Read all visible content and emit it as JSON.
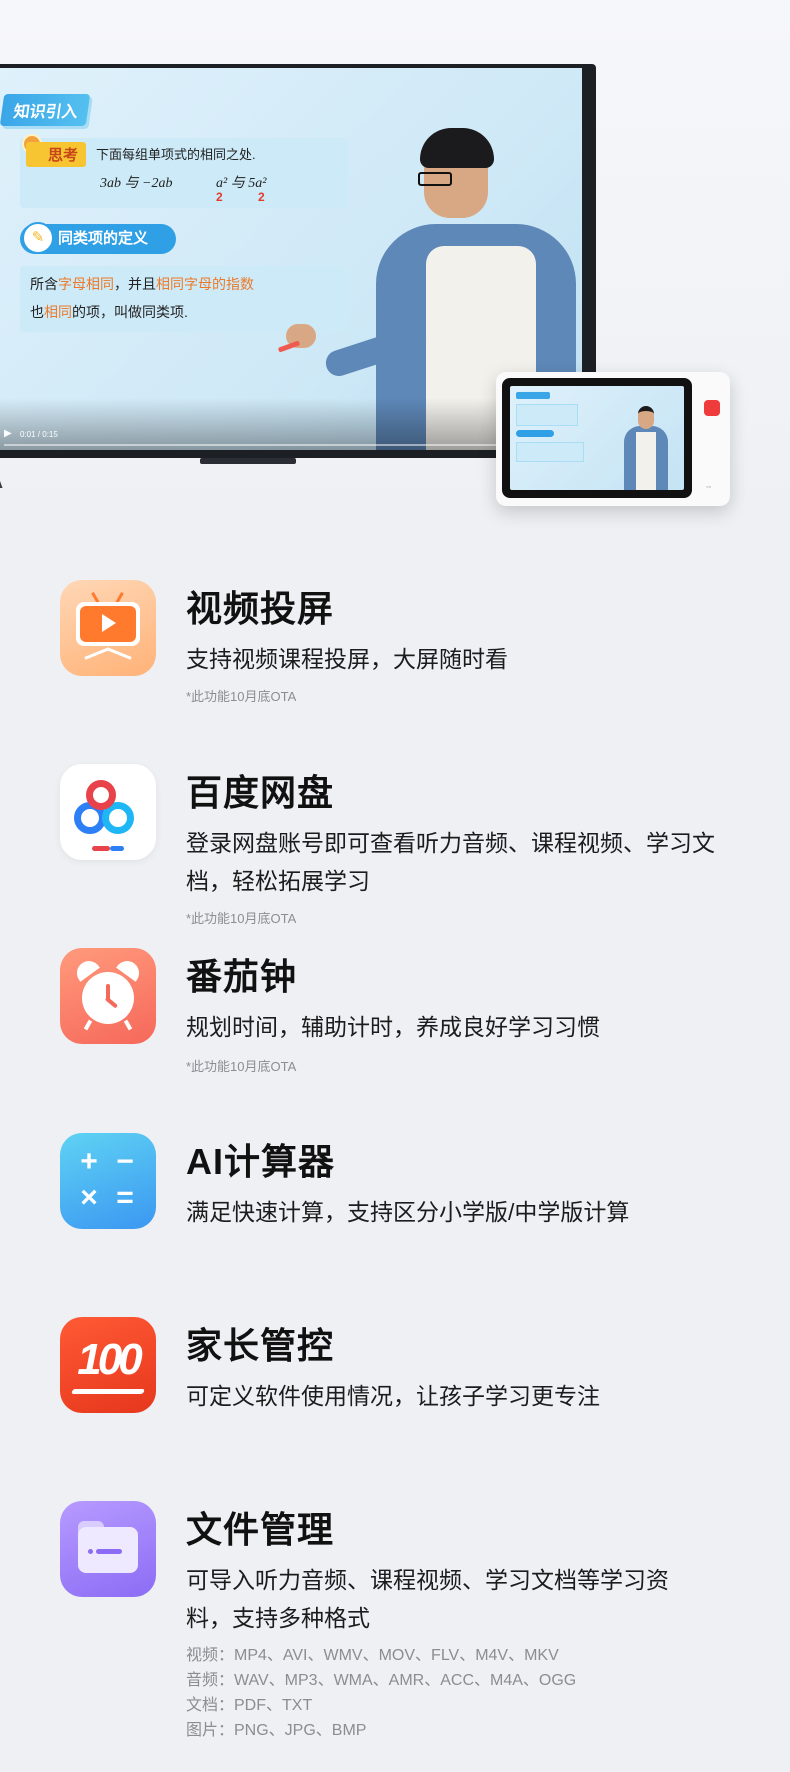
{
  "hero": {
    "knowledge_tag": "知识引入",
    "think_tag": "思考",
    "think_question": "下面每组单项式的相同之处.",
    "expr1": "3ab 与 −2ab",
    "expr2": "a² 与 5a²",
    "red_mark": "2",
    "definition_tag": "同类项的定义",
    "def_line1_a": "所含",
    "def_line1_b": "字母相同",
    "def_line1_c": "，并且",
    "def_line1_d": "相同字母的指数",
    "def_line2_a": "也",
    "def_line2_b": "相同",
    "def_line2_c": "的项，叫做同类项.",
    "player_time": "0:01 / 0:15",
    "play_icon": "▶"
  },
  "features": [
    {
      "title": "视频投屏",
      "desc": "支持视频课程投屏，大屏随时看",
      "note": "*此功能10月底OTA",
      "icon": "screen-cast-icon"
    },
    {
      "title": "百度网盘",
      "desc": "登录网盘账号即可查看听力音频、课程视频、学习文档，轻松拓展学习",
      "note": "*此功能10月底OTA",
      "icon": "baidu-netdisk-icon"
    },
    {
      "title": "番茄钟",
      "desc": "规划时间，辅助计时，养成良好学习习惯",
      "note": "*此功能10月底OTA",
      "icon": "alarm-clock-icon"
    },
    {
      "title": "AI计算器",
      "desc": "满足快速计算，支持区分小学版/中学版计算",
      "icon": "calculator-icon",
      "glyphs": [
        "+",
        "−",
        "×",
        "="
      ]
    },
    {
      "title": "家长管控",
      "desc": "可定义软件使用情况，让孩子学习更专注",
      "icon": "score-100-icon",
      "icon_text": "100"
    },
    {
      "title": "文件管理",
      "desc": "可导入听力音频、课程视频、学习文档等学习资料，支持多种格式",
      "icon": "folder-icon",
      "formats": [
        "视频：MP4、AVI、WMV、MOV、FLV、M4V、MKV",
        "音频：WAV、MP3、WMA、AMR、ACC、M4A、OGG",
        "文档：PDF、TXT",
        "图片：PNG、JPG、BMP"
      ]
    }
  ],
  "colors": {
    "highlight_orange": "#ec7a2a",
    "accent_blue": "#2fa0e6",
    "note_gray": "#8a8d92"
  }
}
